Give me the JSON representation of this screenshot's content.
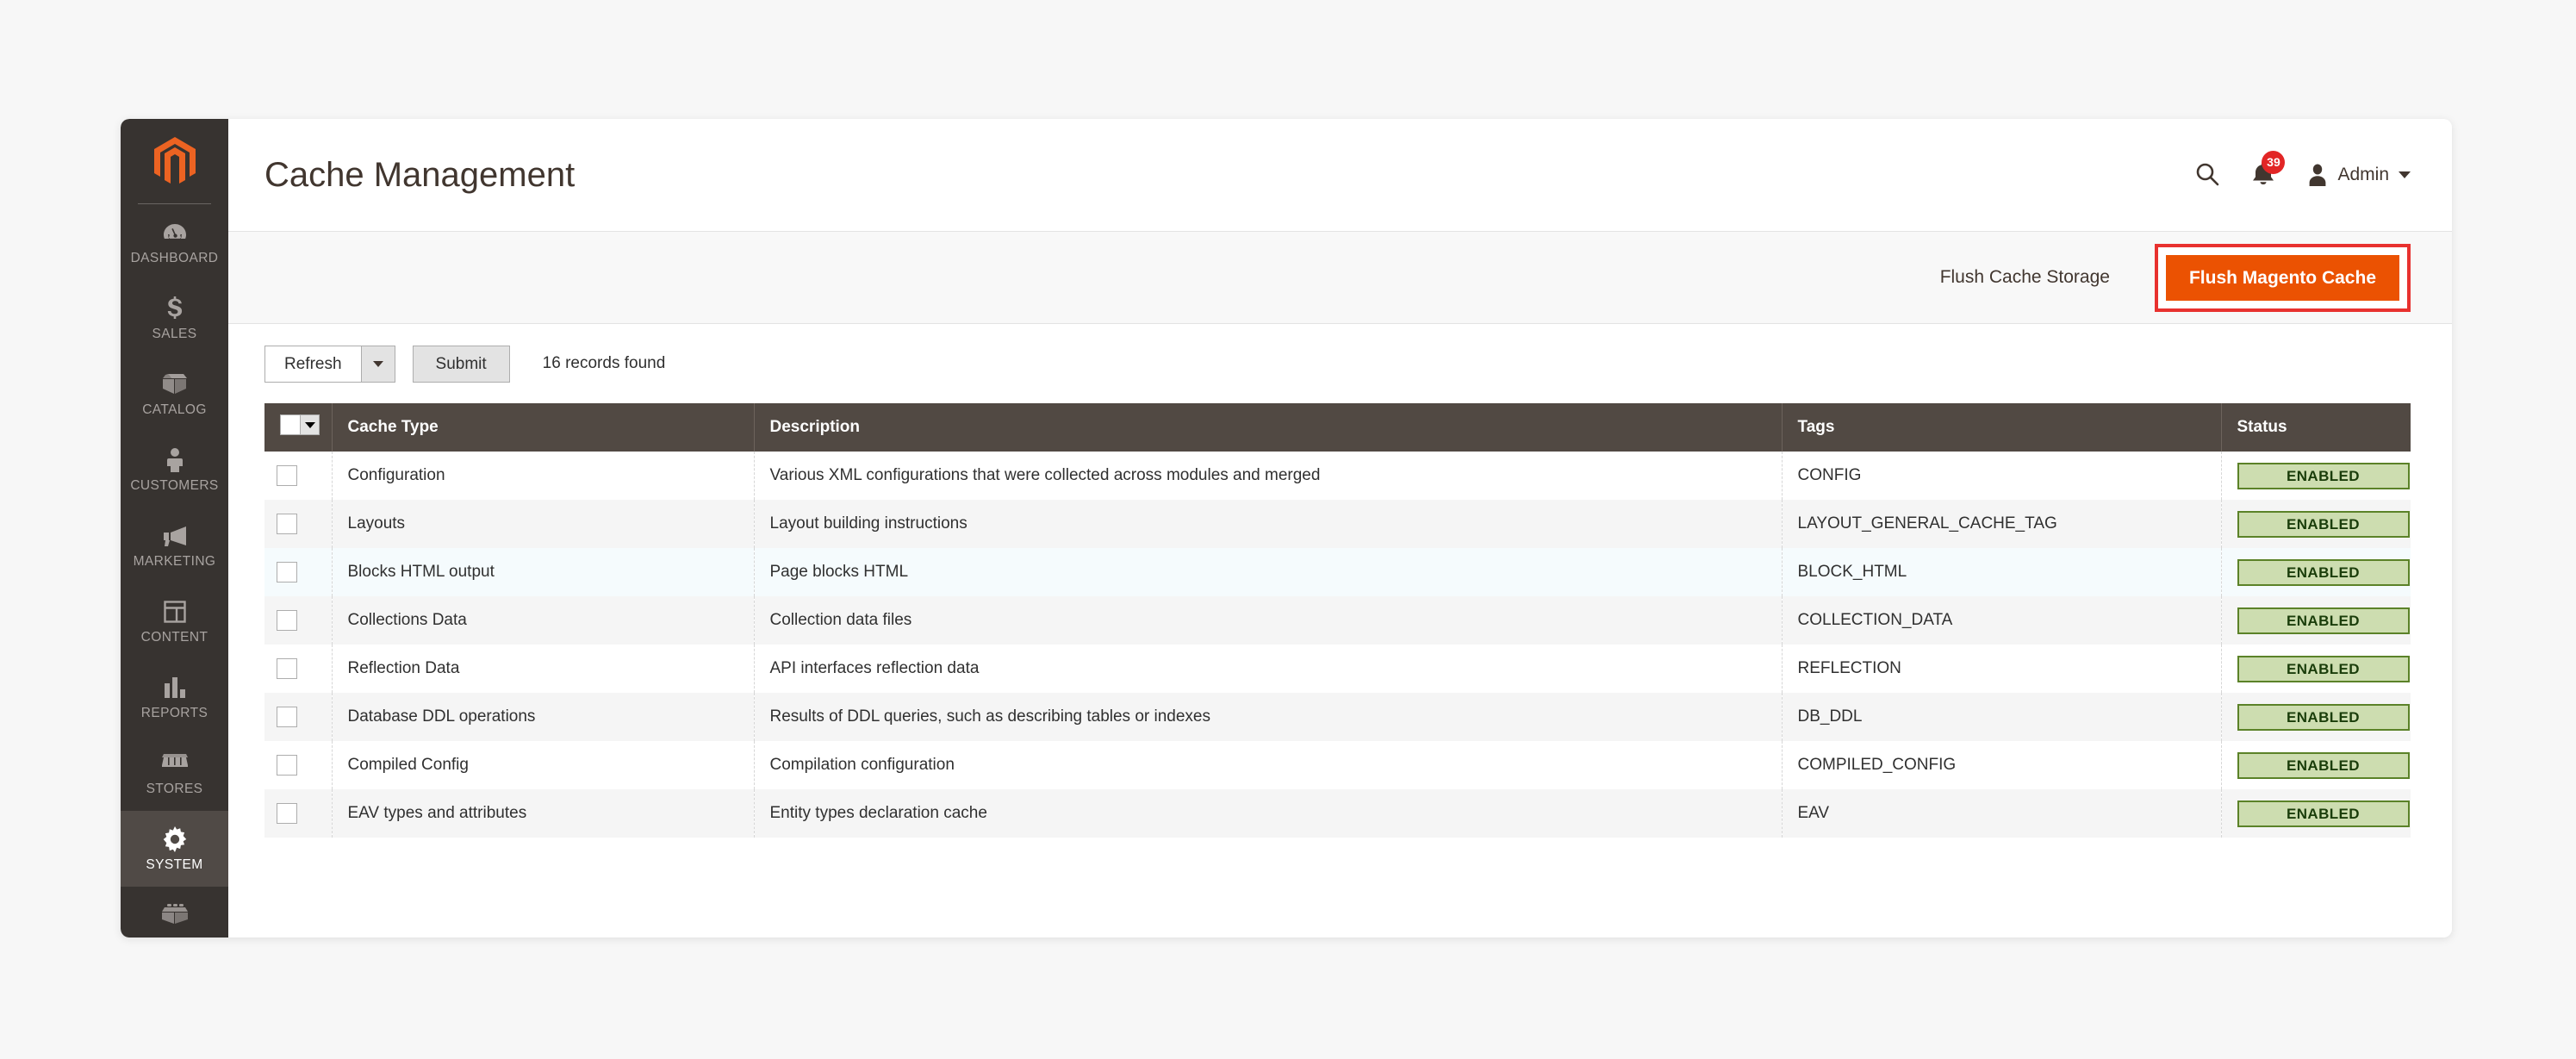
{
  "sidebar": {
    "logo_icon": "magento-logo-icon",
    "items": [
      {
        "label": "DASHBOARD",
        "icon": "dashboard-gauge-icon",
        "active": false
      },
      {
        "label": "SALES",
        "icon": "dollar-sign-icon",
        "active": false
      },
      {
        "label": "CATALOG",
        "icon": "box-package-icon",
        "active": false
      },
      {
        "label": "CUSTOMERS",
        "icon": "person-icon",
        "active": false
      },
      {
        "label": "MARKETING",
        "icon": "megaphone-icon",
        "active": false
      },
      {
        "label": "CONTENT",
        "icon": "layout-page-icon",
        "active": false
      },
      {
        "label": "REPORTS",
        "icon": "bar-chart-icon",
        "active": false
      },
      {
        "label": "STORES",
        "icon": "storefront-icon",
        "active": false
      },
      {
        "label": "SYSTEM",
        "icon": "gear-icon",
        "active": true
      }
    ],
    "tail_icon": "extension-blocks-icon"
  },
  "header": {
    "title": "Cache Management",
    "search_icon": "search-icon",
    "bell_icon": "bell-icon",
    "notification_count": "39",
    "avatar_icon": "user-avatar-icon",
    "admin_label": "Admin",
    "caret_icon": "chevron-down-icon"
  },
  "actions": {
    "flush_cache_storage_label": "Flush Cache Storage",
    "flush_magento_cache_label": "Flush Magento Cache",
    "highlight_color": "#e8312f",
    "primary_color": "#eb5202"
  },
  "toolbar": {
    "mass_action_label": "Refresh",
    "mass_action_caret_icon": "chevron-down-icon",
    "submit_label": "Submit",
    "records_found": "16 records found"
  },
  "grid": {
    "columns": [
      "Cache Type",
      "Description",
      "Tags",
      "Status"
    ],
    "select_all_icon": "checkbox-dropdown-icon",
    "rows": [
      {
        "cache_type": "Configuration",
        "description": "Various XML configurations that were collected across modules and merged",
        "tags": "CONFIG",
        "status": "ENABLED",
        "checked": false,
        "shade": "odd"
      },
      {
        "cache_type": "Layouts",
        "description": "Layout building instructions",
        "tags": "LAYOUT_GENERAL_CACHE_TAG",
        "status": "ENABLED",
        "checked": false,
        "shade": "even"
      },
      {
        "cache_type": "Blocks HTML output",
        "description": "Page blocks HTML",
        "tags": "BLOCK_HTML",
        "status": "ENABLED",
        "checked": false,
        "shade": "hover"
      },
      {
        "cache_type": "Collections Data",
        "description": "Collection data files",
        "tags": "COLLECTION_DATA",
        "status": "ENABLED",
        "checked": false,
        "shade": "even"
      },
      {
        "cache_type": "Reflection Data",
        "description": "API interfaces reflection data",
        "tags": "REFLECTION",
        "status": "ENABLED",
        "checked": false,
        "shade": "odd"
      },
      {
        "cache_type": "Database DDL operations",
        "description": "Results of DDL queries, such as describing tables or indexes",
        "tags": "DB_DDL",
        "status": "ENABLED",
        "checked": false,
        "shade": "even"
      },
      {
        "cache_type": "Compiled Config",
        "description": "Compilation configuration",
        "tags": "COMPILED_CONFIG",
        "status": "ENABLED",
        "checked": false,
        "shade": "odd"
      },
      {
        "cache_type": "EAV types and attributes",
        "description": "Entity types declaration cache",
        "tags": "EAV",
        "status": "ENABLED",
        "checked": false,
        "shade": "even"
      }
    ]
  }
}
